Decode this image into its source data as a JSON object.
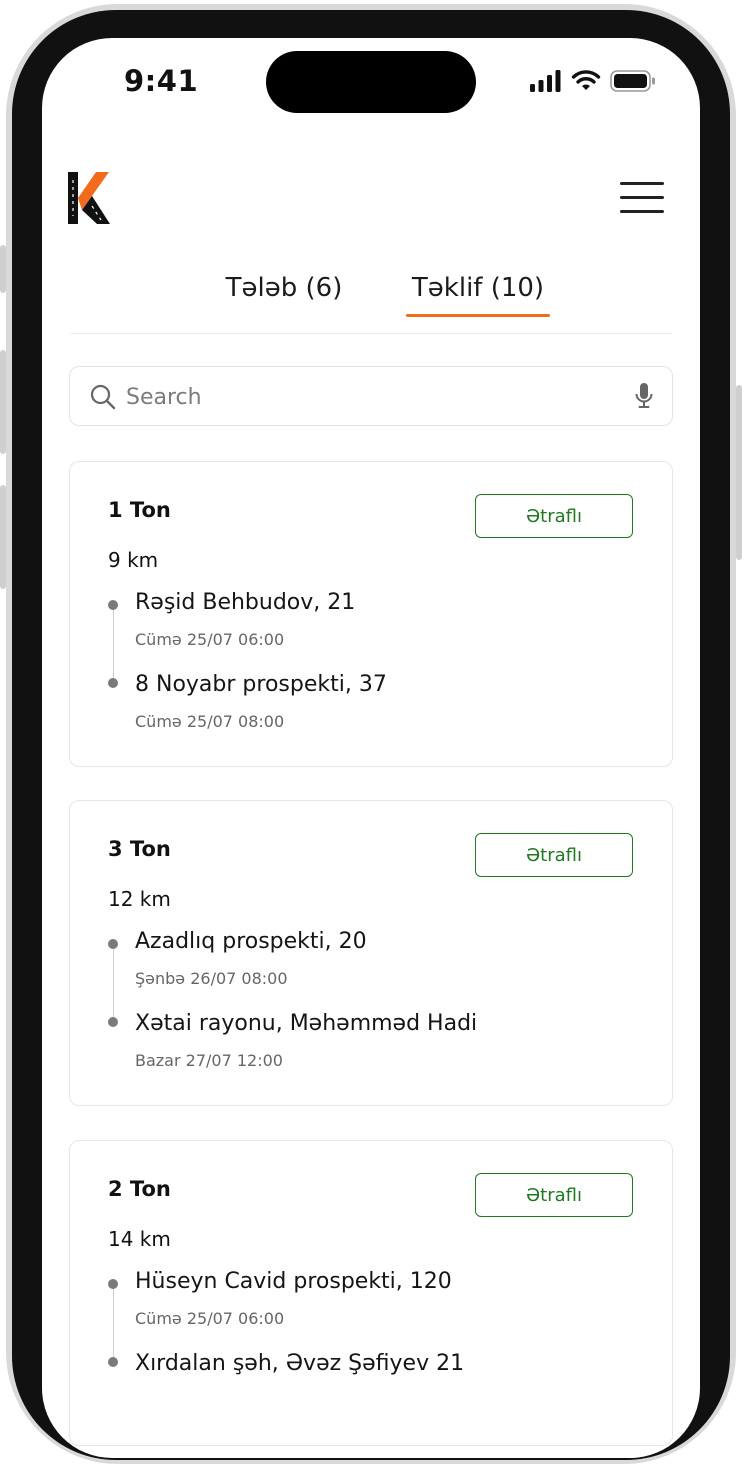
{
  "status": {
    "time": "9:41"
  },
  "tabs": [
    {
      "label": "Tələb (6)"
    },
    {
      "label": "Təklif (10)"
    }
  ],
  "search": {
    "placeholder": "Search"
  },
  "cards": [
    {
      "weight": "1 Ton",
      "distance": "9 km",
      "button": "Ətraflı",
      "from": {
        "address": "Rəşid Behbudov, 21",
        "time": "Cümə 25/07 06:00"
      },
      "to": {
        "address": "8 Noyabr prospekti, 37",
        "time": "Cümə 25/07 08:00"
      }
    },
    {
      "weight": "3 Ton",
      "distance": "12 km",
      "button": "Ətraflı",
      "from": {
        "address": "Azadlıq prospekti, 20",
        "time": "Şənbə 26/07 08:00"
      },
      "to": {
        "address": "Xətai rayonu, Məhəmməd Hadi",
        "time": "Bazar 27/07 12:00"
      }
    },
    {
      "weight": "2 Ton",
      "distance": "14 km",
      "button": "Ətraflı",
      "from": {
        "address": "Hüseyn Cavid prospekti, 120",
        "time": "Cümə 25/07 06:00"
      },
      "to": {
        "address": "Xırdalan şəh, Əvəz Şəfiyev 21",
        "time": ""
      }
    }
  ],
  "colors": {
    "accent": "#f26b1d",
    "button": "#1f7a1f"
  }
}
